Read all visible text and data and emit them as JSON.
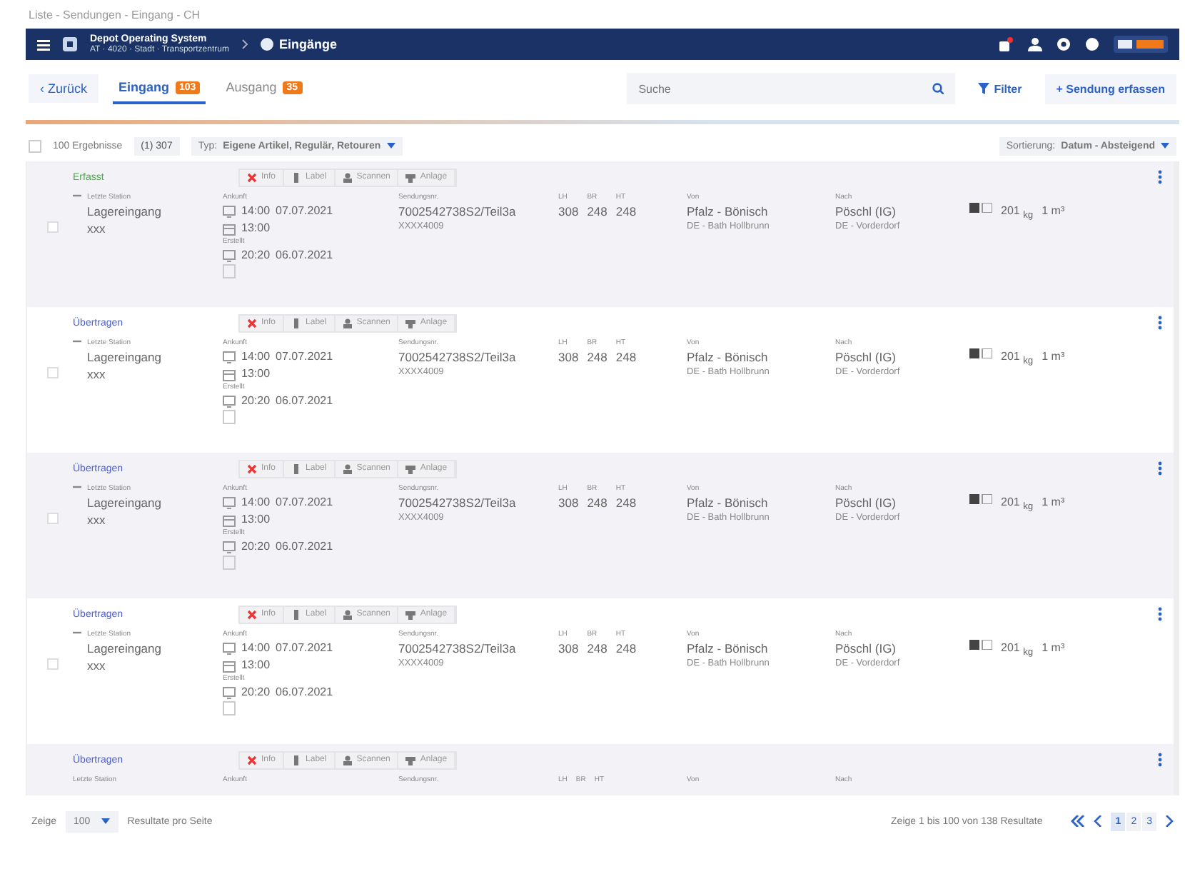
{
  "breadcrumb": "Liste - Sendungen - Eingang - CH",
  "navbar": {
    "app_title": "Depot Operating System",
    "app_subtitle": "AT · 4020 · Stadt · Transportzentrum",
    "section": "Eingänge",
    "notification_dot": true
  },
  "toolbar": {
    "back": "‹ Zurück",
    "tabs": [
      {
        "label": "Eingang",
        "badge": "103",
        "selected": true
      },
      {
        "label": "Ausgang",
        "badge": "35",
        "selected": false
      }
    ],
    "search": {
      "placeholder": "Suche"
    },
    "filter": "Filter",
    "create": "+ Sendung erfassen"
  },
  "filters": {
    "select_all_checked": false,
    "results": "100 Ergebnisse",
    "count_chip": "(1) 307",
    "type_label": "Typ:",
    "type_value": "Eigene Artikel, Regulär, Retouren",
    "sort_label": "Sortierung:",
    "sort_value": "Datum - Absteigend"
  },
  "rows": [
    {
      "status": "Erfasst",
      "color": "#3fae3f",
      "checked": false,
      "actions": [
        "Info",
        "Label",
        "Scannen",
        "Anlage"
      ],
      "station_label": "Letzte Station",
      "station": "Lagereingang",
      "station_sub": "xxx",
      "arrival_label": "Ankunft",
      "arrival_time": "14:00",
      "arrival_date": "07.07.2021",
      "arrival_time2": "13:00",
      "created_label": "Erstellt",
      "created_time": "20:20",
      "created_date": "06.07.2021",
      "ref_label": "Sendungsnr.",
      "ref": "7002542738S2/Teil3a",
      "ref_sub": "XXXX4009",
      "dims": [
        {
          "label": "LH",
          "value": "308"
        },
        {
          "label": "BR",
          "value": "248"
        },
        {
          "label": "HT",
          "value": "248"
        }
      ],
      "from_label": "Von",
      "from": "Pfalz - Bönisch",
      "from_sub": "DE - Bath Hollbrunn",
      "to_label": "Nach",
      "to": "Pöschl (IG)",
      "to_sub": "DE - Vorderdorf",
      "weight": "201",
      "weight_unit": "kg",
      "volume": "1",
      "volume_unit": "m³"
    },
    {
      "status": "Übertragen",
      "color": "#4a5fd8",
      "checked": false,
      "actions": [
        "Info",
        "Label",
        "Scannen",
        "Anlage"
      ],
      "station_label": "Letzte Station",
      "station": "Lagereingang",
      "station_sub": "xxx",
      "arrival_label": "Ankunft",
      "arrival_time": "14:00",
      "arrival_date": "07.07.2021",
      "arrival_time2": "13:00",
      "created_label": "Erstellt",
      "created_time": "20:20",
      "created_date": "06.07.2021",
      "ref_label": "Sendungsnr.",
      "ref": "7002542738S2/Teil3a",
      "ref_sub": "XXXX4009",
      "dims": [
        {
          "label": "LH",
          "value": "308"
        },
        {
          "label": "BR",
          "value": "248"
        },
        {
          "label": "HT",
          "value": "248"
        }
      ],
      "from_label": "Von",
      "from": "Pfalz - Bönisch",
      "from_sub": "DE - Bath Hollbrunn",
      "to_label": "Nach",
      "to": "Pöschl (IG)",
      "to_sub": "DE - Vorderdorf",
      "weight": "201",
      "weight_unit": "kg",
      "volume": "1",
      "volume_unit": "m³"
    },
    {
      "status": "Übertragen",
      "color": "#4a5fd8",
      "checked": false,
      "actions": [
        "Info",
        "Label",
        "Scannen",
        "Anlage"
      ],
      "station_label": "Letzte Station",
      "station": "Lagereingang",
      "station_sub": "xxx",
      "arrival_label": "Ankunft",
      "arrival_time": "14:00",
      "arrival_date": "07.07.2021",
      "arrival_time2": "13:00",
      "created_label": "Erstellt",
      "created_time": "20:20",
      "created_date": "06.07.2021",
      "ref_label": "Sendungsnr.",
      "ref": "7002542738S2/Teil3a",
      "ref_sub": "XXXX4009",
      "dims": [
        {
          "label": "LH",
          "value": "308"
        },
        {
          "label": "BR",
          "value": "248"
        },
        {
          "label": "HT",
          "value": "248"
        }
      ],
      "from_label": "Von",
      "from": "Pfalz - Bönisch",
      "from_sub": "DE - Bath Hollbrunn",
      "to_label": "Nach",
      "to": "Pöschl (IG)",
      "to_sub": "DE - Vorderdorf",
      "weight": "201",
      "weight_unit": "kg",
      "volume": "1",
      "volume_unit": "m³"
    },
    {
      "status": "Übertragen",
      "color": "#4a5fd8",
      "checked": false,
      "actions": [
        "Info",
        "Label",
        "Scannen",
        "Anlage"
      ],
      "station_label": "Letzte Station",
      "station": "Lagereingang",
      "station_sub": "xxx",
      "arrival_label": "Ankunft",
      "arrival_time": "14:00",
      "arrival_date": "07.07.2021",
      "arrival_time2": "13:00",
      "created_label": "Erstellt",
      "created_time": "20:20",
      "created_date": "06.07.2021",
      "ref_label": "Sendungsnr.",
      "ref": "7002542738S2/Teil3a",
      "ref_sub": "XXXX4009",
      "dims": [
        {
          "label": "LH",
          "value": "308"
        },
        {
          "label": "BR",
          "value": "248"
        },
        {
          "label": "HT",
          "value": "248"
        }
      ],
      "from_label": "Von",
      "from": "Pfalz - Bönisch",
      "from_sub": "DE - Bath Hollbrunn",
      "to_label": "Nach",
      "to": "Pöschl (IG)",
      "to_sub": "DE - Vorderdorf",
      "weight": "201",
      "weight_unit": "kg",
      "volume": "1",
      "volume_unit": "m³"
    },
    {
      "status": "Übertragen",
      "color": "#4a5fd8",
      "actions": [
        "Info",
        "Label",
        "Scannen",
        "Anlage"
      ],
      "station_label": "Letzte Station",
      "arrival_label": "Ankunft",
      "ref_label": "Sendungsnr.",
      "dims": [
        {
          "label": "LH"
        },
        {
          "label": "BR"
        },
        {
          "label": "HT"
        }
      ],
      "from_label": "Von",
      "to_label": "Nach"
    }
  ],
  "footer": {
    "show_label": "Zeige",
    "page_size": "100",
    "per_page": "Resultate pro Seite",
    "range": "Zeige 1 bis 100 von 138 Resultate",
    "pages": [
      {
        "label": "1",
        "selected": true
      },
      {
        "label": "2",
        "selected": false
      },
      {
        "label": "3",
        "selected": false
      }
    ]
  }
}
